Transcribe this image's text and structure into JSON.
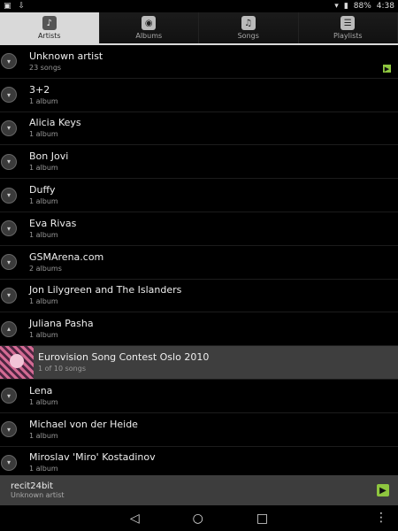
{
  "status": {
    "battery": "88%",
    "time": "4:38"
  },
  "tabs": [
    {
      "label": "Artists",
      "icon": "mic-icon",
      "active": true
    },
    {
      "label": "Albums",
      "icon": "disc-icon",
      "active": false
    },
    {
      "label": "Songs",
      "icon": "note-icon",
      "active": false
    },
    {
      "label": "Playlists",
      "icon": "list-icon",
      "active": false
    }
  ],
  "artists": [
    {
      "title": "Unknown artist",
      "sub": "23 songs"
    },
    {
      "title": "3+2",
      "sub": "1 album"
    },
    {
      "title": "Alicia Keys",
      "sub": "1 album"
    },
    {
      "title": "Bon Jovi",
      "sub": "1 album"
    },
    {
      "title": "Duffy",
      "sub": "1 album"
    },
    {
      "title": "Eva Rivas",
      "sub": "1 album"
    },
    {
      "title": "GSMArena.com",
      "sub": "2 albums"
    },
    {
      "title": "Jon Lilygreen and The Islanders",
      "sub": "1 album"
    },
    {
      "title": "Juliana Pasha",
      "sub": "1 album"
    },
    {
      "title": "Eurovision Song Contest Oslo 2010",
      "sub": "1 of 10 songs"
    },
    {
      "title": "Lena",
      "sub": "1 album"
    },
    {
      "title": "Michael von der Heide",
      "sub": "1 album"
    },
    {
      "title": "Miroslav 'Miro' Kostadinov",
      "sub": "1 album"
    }
  ],
  "nowplaying": {
    "title": "recit24bit",
    "artist": "Unknown artist"
  },
  "colors": {
    "accent": "#8ec63f",
    "tab_active": "#d9d9d9"
  }
}
